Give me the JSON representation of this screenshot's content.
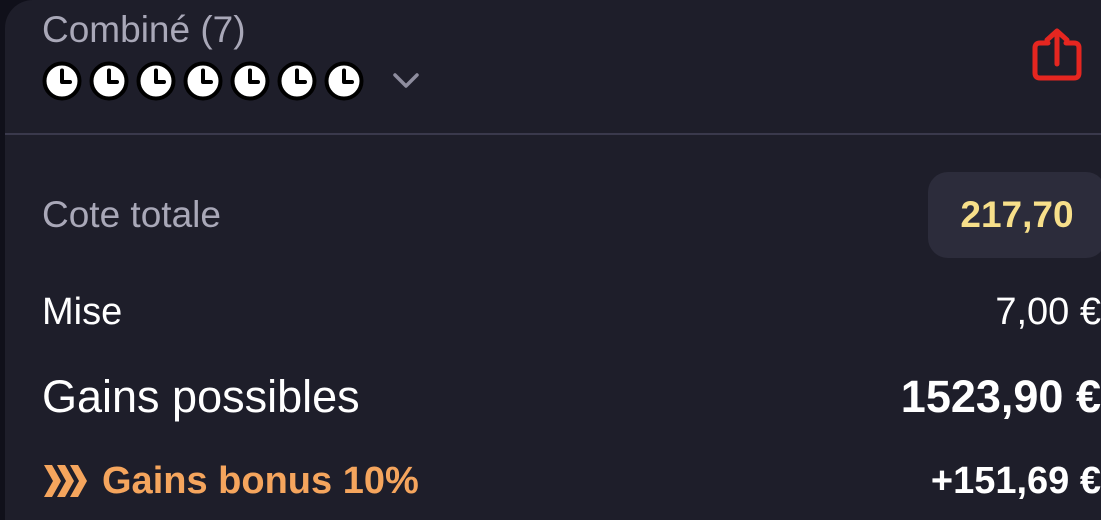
{
  "header": {
    "bet_type": "Combiné (7)",
    "selections_status": [
      "clock-icon",
      "clock-icon",
      "clock-icon",
      "clock-icon",
      "clock-icon",
      "clock-icon",
      "clock-icon"
    ],
    "expand_icon": "chevron-down-icon",
    "share_icon": "share-icon"
  },
  "summary": {
    "total_odds_label": "Cote totale",
    "total_odds_value": "217,70",
    "stake_label": "Mise",
    "stake_value": "7,00 €",
    "potential_gains_label": "Gains possibles",
    "potential_gains_value": "1523,90 €",
    "bonus_icon": "chevrons-right-icon",
    "bonus_label": "Gains bonus 10%",
    "bonus_value": "+151,69 €"
  },
  "colors": {
    "background": "#1e1e2a",
    "muted_text": "#a9a8b8",
    "odds_highlight": "#f7df8a",
    "bonus_accent": "#f5a55d",
    "share_icon": "#e52620"
  }
}
